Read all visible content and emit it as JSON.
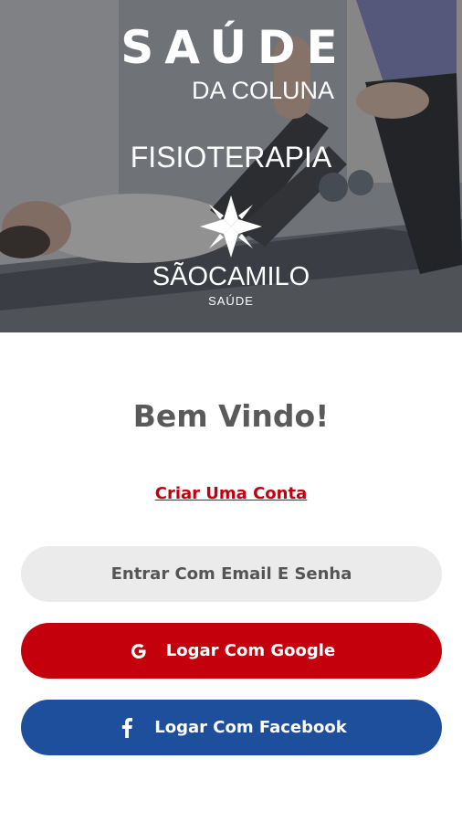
{
  "hero": {
    "title": "SAÚDE",
    "subtitle": "DA COLUNA",
    "section": "FISIOTERAPIA",
    "brand_name": "SÃOCAMILO",
    "brand_sub": "SAÚDE"
  },
  "main": {
    "welcome": "Bem Vindo!",
    "create_account": "Criar Uma Conta"
  },
  "buttons": {
    "email": "Entrar Com Email E Senha",
    "google": "Logar Com Google",
    "facebook": "Logar Com Facebook"
  },
  "icons": {
    "google": "google-icon",
    "facebook": "facebook-icon",
    "brand": "sao-camilo-cross-logo"
  },
  "colors": {
    "google_button": "#c4000d",
    "facebook_button": "#1e4f9c",
    "email_button": "#ebebeb",
    "link": "#c00010",
    "welcome_text": "#5a5a5a"
  }
}
